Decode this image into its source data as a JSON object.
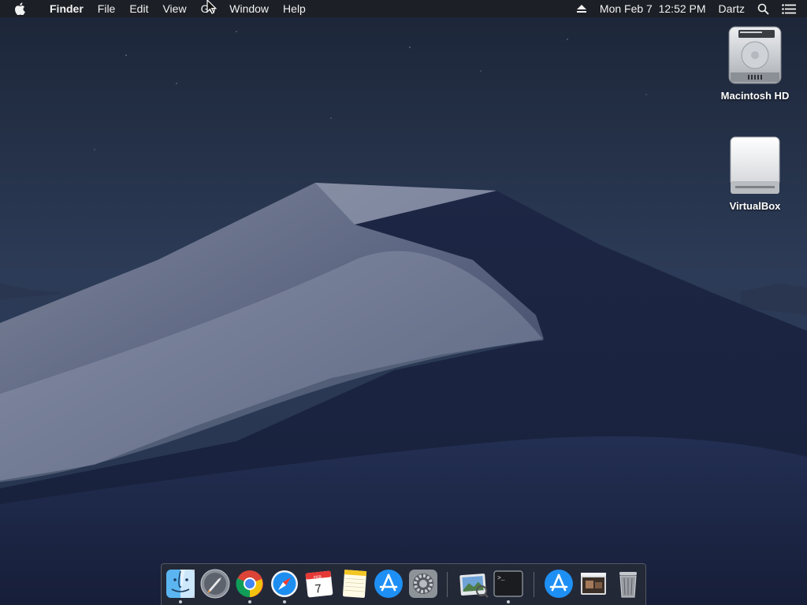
{
  "menubar": {
    "app_name": "Finder",
    "items": [
      "File",
      "Edit",
      "View",
      "Go",
      "Window",
      "Help"
    ],
    "clock": "Mon Feb 7  12:52 PM",
    "user": "Dartz",
    "icons": [
      "apple-icon",
      "eject-icon",
      "spotlight-search-icon",
      "notification-center-icon"
    ]
  },
  "desktop": {
    "icons": [
      {
        "label": "Macintosh HD",
        "icon": "hard-drive-icon"
      },
      {
        "label": "VirtualBox",
        "icon": "external-drive-icon"
      }
    ],
    "wallpaper": "macOS Mojave dark dunes"
  },
  "dock": {
    "apps": [
      {
        "name": "finder-icon",
        "running": true
      },
      {
        "name": "launchpad-icon",
        "running": false
      },
      {
        "name": "chrome-icon",
        "running": true
      },
      {
        "name": "safari-icon",
        "running": true
      },
      {
        "name": "calendar-icon",
        "running": false,
        "month": "FEB",
        "day": "7"
      },
      {
        "name": "notes-icon",
        "running": false
      },
      {
        "name": "app-store-icon",
        "running": false
      },
      {
        "name": "system-preferences-icon",
        "running": false
      },
      {
        "name": "preview-icon",
        "running": false
      },
      {
        "name": "terminal-icon",
        "running": true,
        "prompt": ">_"
      },
      {
        "name": "applications-folder-icon",
        "running": false
      },
      {
        "name": "downloads-stack-icon",
        "running": false
      },
      {
        "name": "trash-icon",
        "running": false
      }
    ]
  },
  "colors": {
    "menubar": "#1c1e24",
    "sky_top": "#1c2638",
    "dune_light": "#8f97aa",
    "dune_shadow": "#17203a"
  }
}
